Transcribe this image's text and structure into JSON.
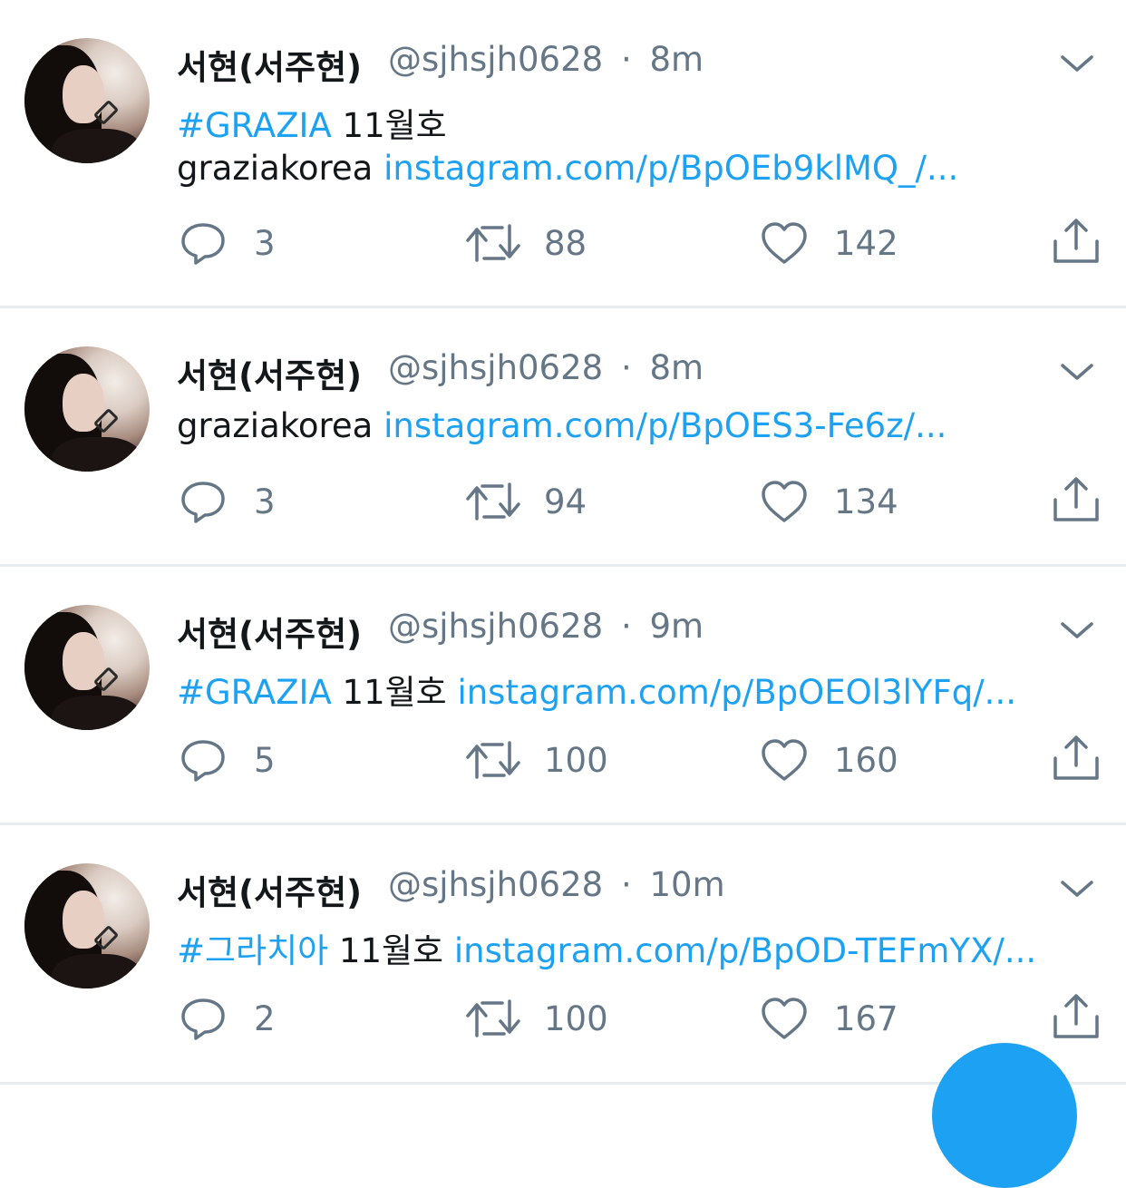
{
  "tweets": [
    {
      "name": "서현(서주현)",
      "handle": "@sjhsjh0628",
      "sep": "·",
      "time": "8m",
      "line1": {
        "hashtag": "#GRAZIA",
        "text": " 11월호",
        "link": ""
      },
      "line2": {
        "hashtag": "",
        "text": "graziakorea ",
        "link": "instagram.com/p/BpOEb9klMQ_/..."
      },
      "replies": "3",
      "retweets": "88",
      "likes": "142"
    },
    {
      "name": "서현(서주현)",
      "handle": "@sjhsjh0628",
      "sep": "·",
      "time": "8m",
      "line1": {
        "hashtag": "",
        "text": "graziakorea ",
        "link": "instagram.com/p/BpOES3-Fe6z/..."
      },
      "replies": "3",
      "retweets": "94",
      "likes": "134"
    },
    {
      "name": "서현(서주현)",
      "handle": "@sjhsjh0628",
      "sep": "·",
      "time": "9m",
      "line1": {
        "hashtag": "#GRAZIA",
        "text": " 11월호 ",
        "link": "instagram.com/p/BpOEOl3lYFq/..."
      },
      "replies": "5",
      "retweets": "100",
      "likes": "160"
    },
    {
      "name": "서현(서주현)",
      "handle": "@sjhsjh0628",
      "sep": "·",
      "time": "10m",
      "line1": {
        "hashtag": "#그라치아",
        "text": " 11월호 ",
        "link": "instagram.com/p/BpOD-TEFmYX/..."
      },
      "replies": "2",
      "retweets": "100",
      "likes": "167"
    }
  ],
  "icons": {
    "reply": "reply-icon",
    "retweet": "retweet-icon",
    "like": "heart-icon",
    "share": "share-icon",
    "caret": "chevron-down-icon"
  },
  "colors": {
    "link": "#1da1f2",
    "secondary": "#657786",
    "divider": "#e6ecf0",
    "fab": "#1da1f2"
  }
}
